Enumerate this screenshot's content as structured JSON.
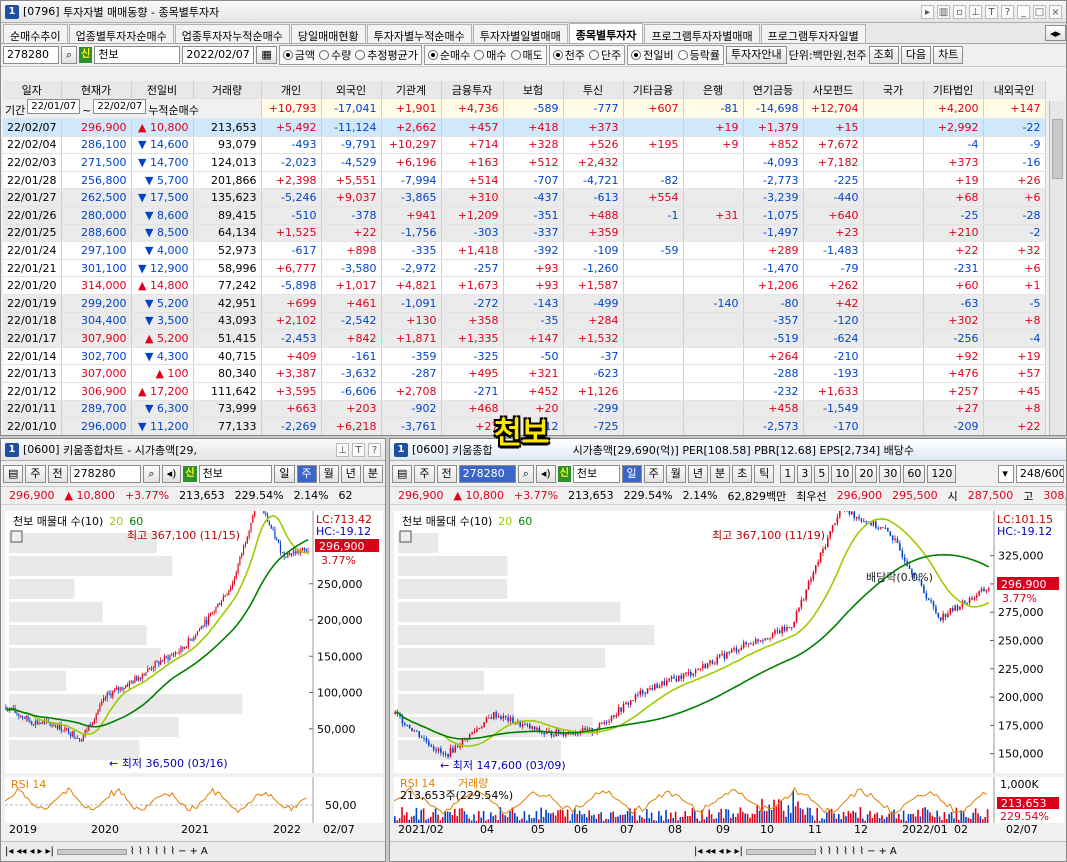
{
  "investor_window": {
    "title_code": "[0796]",
    "title": "투자자별 매매동향 - 종목별투자자",
    "tabs": [
      "순매수추이",
      "업종별투자자순매수",
      "업종투자자누적순매수",
      "당일매매현황",
      "투자자별누적순매수",
      "투자자별일별매매",
      "종목별투자자",
      "프로그램투자자별매매",
      "프로그램투자자일별"
    ],
    "selected_tab": "종목별투자자",
    "stock_code": "278280",
    "stock_name": "천보",
    "date": "2022/02/07",
    "radio_group1": [
      "금액",
      "수량",
      "추정평균가"
    ],
    "radio_group1_selected": "금액",
    "radio_group2": [
      "순매수",
      "매수",
      "매도"
    ],
    "radio_group2_selected": "순매수",
    "radio_group3": [
      "천주",
      "단주"
    ],
    "radio_group3_selected": "천주",
    "radio_group4": [
      "전일비",
      "등락률"
    ],
    "radio_group4_selected": "전일비",
    "guide_button": "투자자안내",
    "unit_label": "단위:백만원,천주",
    "search_button": "조회",
    "next_button": "다음",
    "chart_button": "차트",
    "period_label": "기간",
    "period_from": "22/01/07",
    "period_to": "22/02/07",
    "cumulative_label": "누적순매수",
    "columns": [
      "일자",
      "현재가",
      "전일비",
      "거래량",
      "개인",
      "외국인",
      "기관계",
      "금융투자",
      "보험",
      "투신",
      "기타금융",
      "은행",
      "연기금등",
      "사모펀드",
      "국가",
      "기타법인",
      "내외국인"
    ],
    "cumulative": [
      "+10,793",
      "-17,041",
      "+1,901",
      "+4,736",
      "-589",
      "-777",
      "+607",
      "-81",
      "-14,698",
      "+12,704",
      "",
      "+4,200",
      "+147"
    ],
    "rows": [
      [
        "22/02/07",
        "296,900",
        "up",
        "10,800",
        "213,653",
        "+5,492",
        "-11,124",
        "+2,662",
        "+457",
        "+418",
        "+373",
        "",
        "+19",
        "+1,379",
        "+15",
        "",
        "+2,992",
        "-22"
      ],
      [
        "22/02/04",
        "286,100",
        "dn",
        "14,600",
        "93,079",
        "-493",
        "-9,791",
        "+10,297",
        "+714",
        "+328",
        "+526",
        "+195",
        "+9",
        "+852",
        "+7,672",
        "",
        "-4",
        "-9"
      ],
      [
        "22/02/03",
        "271,500",
        "dn",
        "14,700",
        "124,013",
        "-2,023",
        "-4,529",
        "+6,196",
        "+163",
        "+512",
        "+2,432",
        "",
        "",
        "-4,093",
        "+7,182",
        "",
        "+373",
        "-16"
      ],
      [
        "22/01/28",
        "256,800",
        "dn",
        "5,700",
        "201,866",
        "+2,398",
        "+5,551",
        "-7,994",
        "+514",
        "-707",
        "-4,721",
        "-82",
        "",
        "-2,773",
        "-225",
        "",
        "+19",
        "+26"
      ],
      [
        "22/01/27",
        "262,500",
        "dn",
        "17,500",
        "135,623",
        "-5,246",
        "+9,037",
        "-3,865",
        "+310",
        "-437",
        "-613",
        "+554",
        "",
        "-3,239",
        "-440",
        "",
        "+68",
        "+6"
      ],
      [
        "22/01/26",
        "280,000",
        "dn",
        "8,600",
        "89,415",
        "-510",
        "-378",
        "+941",
        "+1,209",
        "-351",
        "+488",
        "-1",
        "+31",
        "-1,075",
        "+640",
        "",
        "-25",
        "-28"
      ],
      [
        "22/01/25",
        "288,600",
        "dn",
        "8,500",
        "64,134",
        "+1,525",
        "+22",
        "-1,756",
        "-303",
        "-337",
        "+359",
        "",
        "",
        "-1,497",
        "+23",
        "",
        "+210",
        "-2"
      ],
      [
        "22/01/24",
        "297,100",
        "dn",
        "4,000",
        "52,973",
        "-617",
        "+898",
        "-335",
        "+1,418",
        "-392",
        "-109",
        "-59",
        "",
        "+289",
        "-1,483",
        "",
        "+22",
        "+32"
      ],
      [
        "22/01/21",
        "301,100",
        "dn",
        "12,900",
        "58,996",
        "+6,777",
        "-3,580",
        "-2,972",
        "-257",
        "+93",
        "-1,260",
        "",
        "",
        "-1,470",
        "-79",
        "",
        "-231",
        "+6"
      ],
      [
        "22/01/20",
        "314,000",
        "up",
        "14,800",
        "77,242",
        "-5,898",
        "+1,017",
        "+4,821",
        "+1,673",
        "+93",
        "+1,587",
        "",
        "",
        "+1,206",
        "+262",
        "",
        "+60",
        "+1"
      ],
      [
        "22/01/19",
        "299,200",
        "dn",
        "5,200",
        "42,951",
        "+699",
        "+461",
        "-1,091",
        "-272",
        "-143",
        "-499",
        "",
        "-140",
        "-80",
        "+42",
        "",
        "-63",
        "-5"
      ],
      [
        "22/01/18",
        "304,400",
        "dn",
        "3,500",
        "43,093",
        "+2,102",
        "-2,542",
        "+130",
        "+358",
        "-35",
        "+284",
        "",
        "",
        "-357",
        "-120",
        "",
        "+302",
        "+8"
      ],
      [
        "22/01/17",
        "307,900",
        "up",
        "5,200",
        "51,415",
        "-2,453",
        "+842",
        "+1,871",
        "+1,335",
        "+147",
        "+1,532",
        "",
        "",
        "-519",
        "-624",
        "",
        "-256",
        "-4"
      ],
      [
        "22/01/14",
        "302,700",
        "dn",
        "4,300",
        "40,715",
        "+409",
        "-161",
        "-359",
        "-325",
        "-50",
        "-37",
        "",
        "",
        "+264",
        "-210",
        "",
        "+92",
        "+19"
      ],
      [
        "22/01/13",
        "307,000",
        "up",
        "100",
        "80,340",
        "+3,387",
        "-3,632",
        "-287",
        "+495",
        "+321",
        "-623",
        "",
        "",
        "-288",
        "-193",
        "",
        "+476",
        "+57"
      ],
      [
        "22/01/12",
        "306,900",
        "up",
        "17,200",
        "111,642",
        "+3,595",
        "-6,606",
        "+2,708",
        "-271",
        "+452",
        "+1,126",
        "",
        "",
        "-232",
        "+1,633",
        "",
        "+257",
        "+45"
      ],
      [
        "22/01/11",
        "289,700",
        "dn",
        "6,300",
        "73,999",
        "+663",
        "+203",
        "-902",
        "+468",
        "+20",
        "-299",
        "",
        "",
        "+458",
        "-1,549",
        "",
        "+27",
        "+8"
      ],
      [
        "22/01/10",
        "296,000",
        "dn",
        "11,200",
        "77,133",
        "-2,269",
        "+6,218",
        "-3,761",
        "+27",
        "-112",
        "-725",
        "",
        "",
        "-2,573",
        "-170",
        "",
        "-209",
        "+22"
      ]
    ]
  },
  "overlay_title": "천보",
  "chart_left": {
    "title_code": "[0600]",
    "title": "키움종합차트 - 시가총액[29,",
    "code": "278280",
    "name": "천보",
    "period_buttons": [
      "일",
      "주",
      "월",
      "년",
      "분"
    ],
    "selected_period": "주",
    "price": "296,900",
    "change": "10,800",
    "change_pct": "+3.77%",
    "volume": "213,653",
    "ratio": "229.54%",
    "turnover": "2.14%",
    "extra": "62",
    "legend": "천보 매물대 수(10)",
    "ma1": "20",
    "ma2": "60",
    "lc": "LC:713.42",
    "hc": "HC:-19.12",
    "high_label": "최고 367,100 (11/15)",
    "low_label": "최저 36,500 (03/16)",
    "price_tag": "296,900",
    "pct_tag": "3.77%",
    "y_ticks": [
      "250,000",
      "200,000",
      "150,000",
      "100,000",
      "50,000"
    ],
    "x_ticks": [
      "2019",
      "2020",
      "2021",
      "2022"
    ],
    "x_end": "02/07",
    "rsi_label": "RSI 14",
    "rsi_tick": "50,00"
  },
  "chart_right": {
    "title_code": "[0600]",
    "title": "키움종합",
    "title_rest": "시가총액[29,690(억)] PER[108.58] PBR[12.68] EPS[2,734] 배당수",
    "code": "278280",
    "name": "천보",
    "period_buttons": [
      "일",
      "주",
      "월",
      "년",
      "분",
      "초",
      "틱"
    ],
    "selected_period": "일",
    "number_buttons": [
      "1",
      "3",
      "5",
      "10",
      "20",
      "30",
      "60",
      "120"
    ],
    "count": "248",
    "count_total": "/600",
    "price": "296,900",
    "change": "10,800",
    "change_pct": "+3.77%",
    "volume": "213,653",
    "ratio": "229.54%",
    "turnover": "2.14%",
    "amount": "62,829백만",
    "best_ask_label": "최우선",
    "best_ask": "296,900",
    "best_bid": "295,500",
    "open_label": "시",
    "open": "287,500",
    "high_label_short": "고",
    "high_value": "308,",
    "legend": "천보 매물대 수(10)",
    "ma1": "20",
    "ma2": "60",
    "lc": "LC:101.15",
    "hc": "HC:-19.12",
    "high_label": "최고 367,100 (11/19)",
    "low_label": "최저 147,600 (03/09)",
    "dividend_label": "배당락(0.0%)",
    "price_tag": "296,900",
    "pct_tag": "3.77%",
    "y_ticks": [
      "325,000",
      "300,000",
      "275,000",
      "250,000",
      "225,000",
      "200,000",
      "175,000",
      "150,000"
    ],
    "x_ticks": [
      "2021/02",
      "04",
      "05",
      "06",
      "07",
      "08",
      "09",
      "10",
      "11",
      "12",
      "2022/01",
      "02"
    ],
    "x_end": "02/07",
    "sub_label": "RSI 14",
    "sub_label2": "거래량",
    "vol_label": "213,653주(229.54%)",
    "vol_tick": "1,000K",
    "vol_tag": "213,653",
    "vol_pct_tag": "229.54%"
  },
  "chart_data": [
    {
      "type": "line",
      "title": "",
      "series": [
        {
          "name": "천보",
          "x": [
            "2019-01",
            "2019-06",
            "2020-01",
            "2020-03",
            "2020-06",
            "2020-10",
            "2021-01",
            "2021-04",
            "2021-07",
            "2021-09",
            "2021-11",
            "2022-01",
            "2022-02"
          ],
          "values": [
            80000,
            60000,
            55000,
            36500,
            95000,
            115000,
            140000,
            160000,
            200000,
            250000,
            367100,
            290000,
            296900
          ]
        }
      ],
      "ylim": [
        0,
        320000
      ]
    },
    {
      "type": "line",
      "title": "",
      "series": [
        {
          "name": "천보",
          "x": [
            "2021-02",
            "2021-03",
            "2021-04",
            "2021-05",
            "2021-06",
            "2021-07",
            "2021-08",
            "2021-09",
            "2021-10",
            "2021-11",
            "2021-12",
            "2022-01",
            "2022-02"
          ],
          "values": [
            185000,
            147600,
            185000,
            168000,
            170000,
            205000,
            222000,
            245000,
            262000,
            367100,
            345000,
            270000,
            296900
          ]
        }
      ],
      "ylim": [
        140000,
        345000
      ]
    }
  ]
}
